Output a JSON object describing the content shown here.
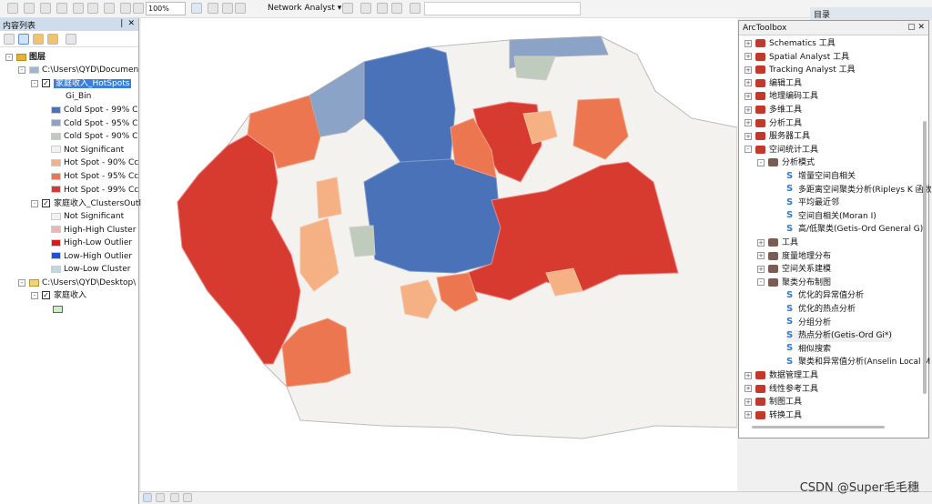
{
  "toolbar": {
    "zoom": "100%",
    "network_analyst": "Network Analyst ▾"
  },
  "toc": {
    "title": "内容列表",
    "pin": "❘",
    "close": "✕",
    "root": "图层",
    "db_path": "C:\\Users\\QYD\\Documen",
    "layer1": "家庭收入_HotSpots",
    "layer1_field": "Gi_Bin",
    "legend1": [
      {
        "label": "Cold Spot - 99% C",
        "color": "#4a72b8"
      },
      {
        "label": "Cold Spot - 95% C",
        "color": "#8ba3c6"
      },
      {
        "label": "Cold Spot - 90% C",
        "color": "#bfcbbc"
      },
      {
        "label": "Not Significant",
        "color": "#f3f2ee"
      },
      {
        "label": "Hot Spot - 90% Cc",
        "color": "#f5b083"
      },
      {
        "label": "Hot Spot - 95% Cc",
        "color": "#ec7650"
      },
      {
        "label": "Hot Spot - 99% Cc",
        "color": "#d73a2e"
      }
    ],
    "layer2": "家庭收入_ClustersOutl",
    "legend2": [
      {
        "label": "Not Significant",
        "color": "#f3f2ee"
      },
      {
        "label": "High-High Cluster",
        "color": "#f0b4b0"
      },
      {
        "label": "High-Low Outlier",
        "color": "#e0161a"
      },
      {
        "label": "Low-High Outlier",
        "color": "#1e4fe0"
      },
      {
        "label": "Low-Low Cluster",
        "color": "#b8dbe6"
      }
    ],
    "folder_path": "C:\\Users\\QYD\\Desktop\\",
    "layer3": "家庭收入",
    "layer3_color": "#c8f0c0"
  },
  "catalog_tab": "目录",
  "toolbox": {
    "title": "ArcToolbox",
    "items": [
      {
        "label": "Schematics 工具",
        "level": 0,
        "type": "box",
        "exp": "+"
      },
      {
        "label": "Spatial Analyst 工具",
        "level": 0,
        "type": "box",
        "exp": "+"
      },
      {
        "label": "Tracking Analyst 工具",
        "level": 0,
        "type": "box",
        "exp": "+"
      },
      {
        "label": "编辑工具",
        "level": 0,
        "type": "box",
        "exp": "+"
      },
      {
        "label": "地理编码工具",
        "level": 0,
        "type": "box",
        "exp": "+"
      },
      {
        "label": "多维工具",
        "level": 0,
        "type": "box",
        "exp": "+"
      },
      {
        "label": "分析工具",
        "level": 0,
        "type": "box",
        "exp": "+"
      },
      {
        "label": "服务器工具",
        "level": 0,
        "type": "box",
        "exp": "+"
      },
      {
        "label": "空间统计工具",
        "level": 0,
        "type": "box",
        "exp": "-"
      },
      {
        "label": "分析模式",
        "level": 1,
        "type": "set",
        "exp": "-"
      },
      {
        "label": "增量空间自相关",
        "level": 2,
        "type": "script"
      },
      {
        "label": "多距离空间聚类分析(Ripleys K 函数",
        "level": 2,
        "type": "script"
      },
      {
        "label": "平均最近邻",
        "level": 2,
        "type": "script"
      },
      {
        "label": "空间自相关(Moran I)",
        "level": 2,
        "type": "script"
      },
      {
        "label": "高/低聚类(Getis-Ord General G)",
        "level": 2,
        "type": "script"
      },
      {
        "label": "工具",
        "level": 1,
        "type": "set",
        "exp": "+"
      },
      {
        "label": "度量地理分布",
        "level": 1,
        "type": "set",
        "exp": "+"
      },
      {
        "label": "空间关系建模",
        "level": 1,
        "type": "set",
        "exp": "+"
      },
      {
        "label": "聚类分布制图",
        "level": 1,
        "type": "set",
        "exp": "-"
      },
      {
        "label": "优化的异常值分析",
        "level": 2,
        "type": "script"
      },
      {
        "label": "优化的热点分析",
        "level": 2,
        "type": "script"
      },
      {
        "label": "分组分析",
        "level": 2,
        "type": "script"
      },
      {
        "label": "热点分析(Getis-Ord Gi*)",
        "level": 2,
        "type": "script",
        "hover": true
      },
      {
        "label": "相似搜索",
        "level": 2,
        "type": "script"
      },
      {
        "label": "聚类和异常值分析(Anselin Local M",
        "level": 2,
        "type": "script"
      },
      {
        "label": "数据管理工具",
        "level": 0,
        "type": "box",
        "exp": "+"
      },
      {
        "label": "线性参考工具",
        "level": 0,
        "type": "box",
        "exp": "+"
      },
      {
        "label": "制图工具",
        "level": 0,
        "type": "box",
        "exp": "+"
      },
      {
        "label": "转换工具",
        "level": 0,
        "type": "box",
        "exp": "+"
      }
    ]
  },
  "watermark": "CSDN @Super毛毛穗"
}
